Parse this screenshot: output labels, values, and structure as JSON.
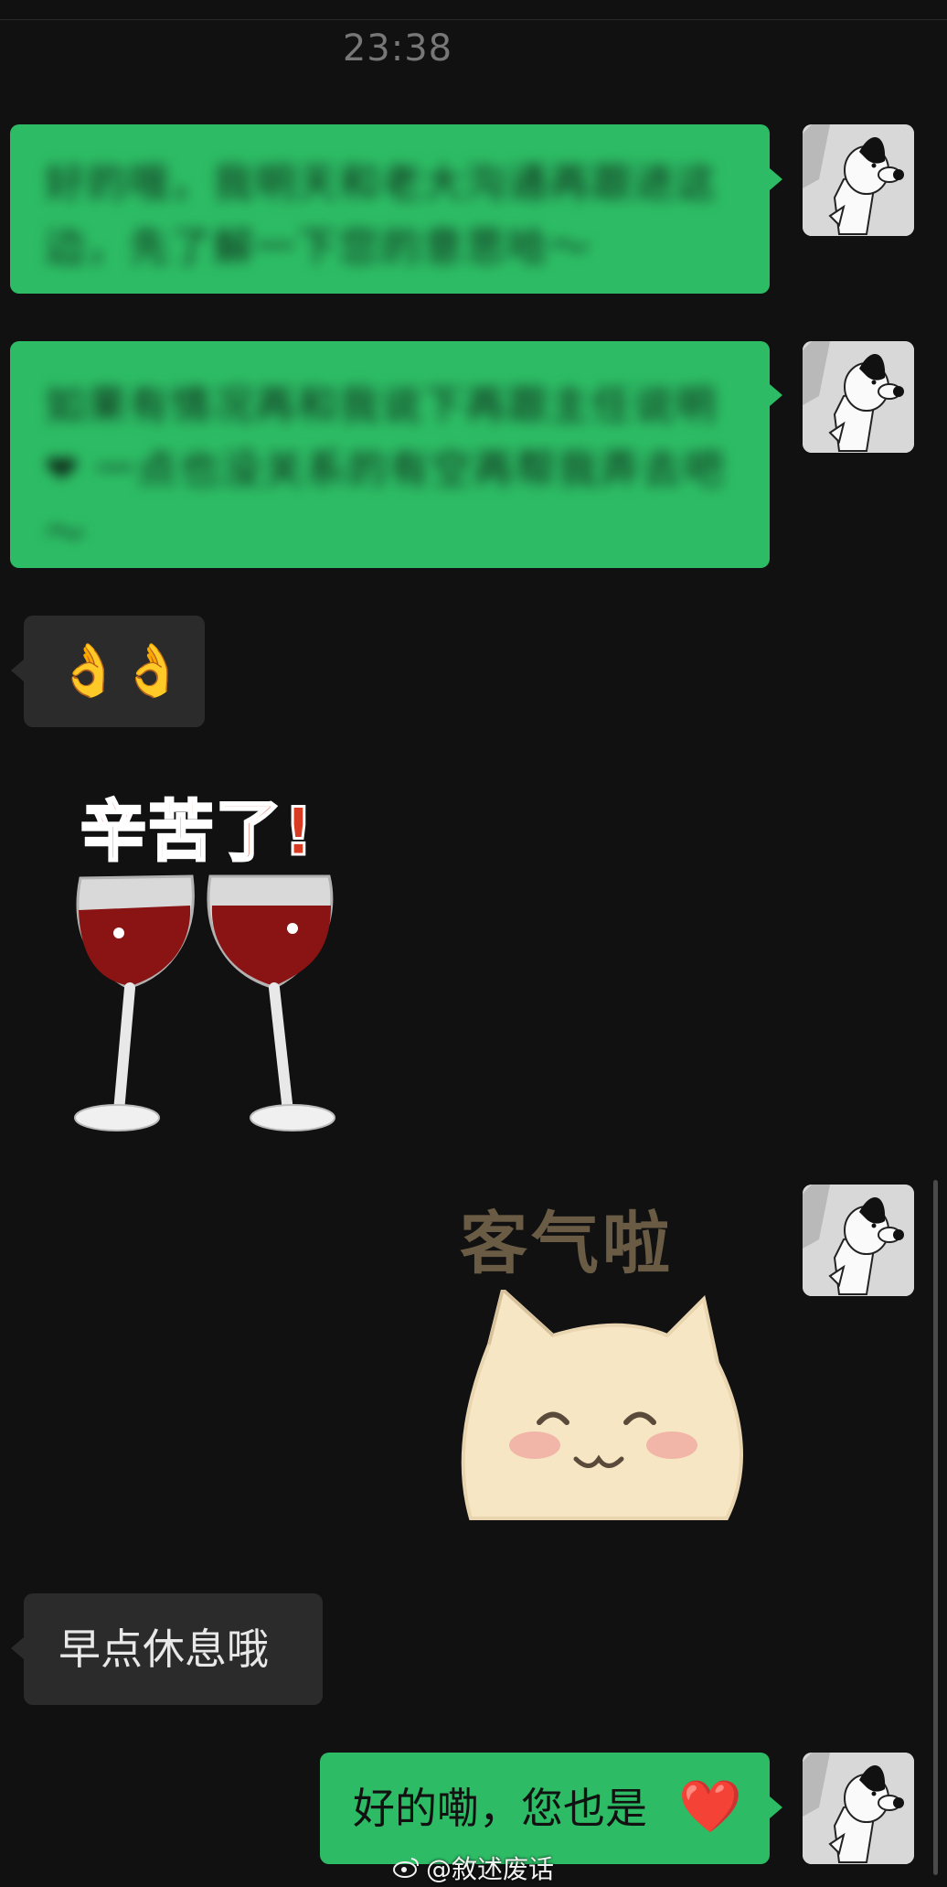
{
  "chat": {
    "timestamp": "23:38",
    "messages": [
      {
        "side": "out",
        "type": "text",
        "text": "好的哦，我明天和老大沟通再跟进这边，先了解一下您的意思哈～"
      },
      {
        "side": "out",
        "type": "text",
        "text": "如果有情况再和我说下再跟主任说明 ❤ 一点也没关系的有空再帮我弄去吧～"
      },
      {
        "side": "in",
        "type": "emoji",
        "text": "👌👌"
      },
      {
        "side": "in",
        "type": "sticker",
        "text": "辛苦了!",
        "icon": "wine-toast-sticker"
      },
      {
        "side": "out",
        "type": "sticker",
        "text": "客气啦",
        "icon": "smiling-cat-sticker"
      },
      {
        "side": "in",
        "type": "text",
        "text": "早点休息哦"
      },
      {
        "side": "out",
        "type": "text",
        "text": "好的嘞，您也是",
        "emoji": "❤️"
      }
    ]
  },
  "avatar_icon": "snoopy-avatar",
  "watermark": {
    "text": "@敘述废话",
    "icon": "weibo-icon"
  },
  "colors": {
    "background": "#111111",
    "outgoing": "#2dbc65",
    "incoming": "#2b2b2b"
  }
}
